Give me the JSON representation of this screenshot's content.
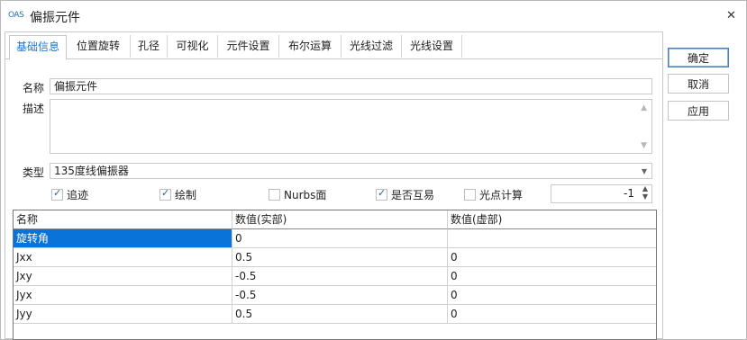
{
  "window": {
    "logo": "OAS",
    "title": "偏振元件"
  },
  "tabs": [
    {
      "label": "基础信息"
    },
    {
      "label": "位置旋转"
    },
    {
      "label": "孔径"
    },
    {
      "label": "可视化"
    },
    {
      "label": "元件设置"
    },
    {
      "label": "布尔运算"
    },
    {
      "label": "光线过滤"
    },
    {
      "label": "光线设置"
    }
  ],
  "form": {
    "name_label": "名称",
    "name_value": "偏振元件",
    "desc_label": "描述",
    "desc_value": "",
    "type_label": "类型",
    "type_value": "135度线偏振器"
  },
  "options": [
    {
      "label": "追迹",
      "checked": true
    },
    {
      "label": "绘制",
      "checked": true
    },
    {
      "label": "Nurbs面",
      "checked": false
    },
    {
      "label": "是否互易",
      "checked": true
    },
    {
      "label": "光点计算",
      "checked": false
    }
  ],
  "spin_value": "-1",
  "table": {
    "headers": [
      "名称",
      "数值(实部)",
      "数值(虚部)"
    ],
    "rows": [
      [
        "旋转角",
        "0",
        ""
      ],
      [
        "Jxx",
        "0.5",
        "0"
      ],
      [
        "Jxy",
        "-0.5",
        "0"
      ],
      [
        "Jyx",
        "-0.5",
        "0"
      ],
      [
        "Jyy",
        "0.5",
        "0"
      ]
    ],
    "selected_row": 0
  },
  "buttons": {
    "ok": "确定",
    "cancel": "取消",
    "apply": "应用"
  },
  "icons": {
    "close": "close-icon",
    "combo": "chevron-down-icon",
    "spin": "spin-arrows-icon"
  }
}
